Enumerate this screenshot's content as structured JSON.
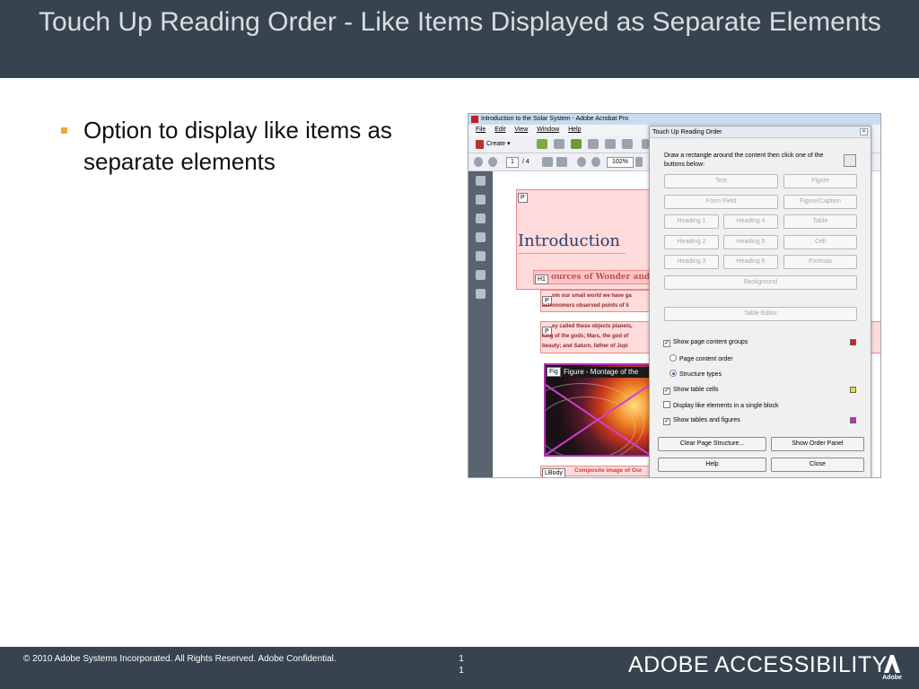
{
  "slide": {
    "title": "Touch Up Reading Order - Like Items Displayed as Separate Elements",
    "bullet": "Option to display like items as separate elements"
  },
  "acrobat": {
    "window_title": "Introduction to the Solar System - Adobe Acrobat Pro",
    "menu": [
      "File",
      "Edit",
      "View",
      "Window",
      "Help"
    ],
    "create_label": "Create",
    "page_current": "1",
    "page_total": "/ 4",
    "zoom": "102%",
    "document": {
      "heading": "Introduction",
      "subheading": "ources of Wonder and",
      "para1_line1": "om our small world we have ga",
      "para1_line2": "astronomers observed points of li",
      "para2_line1": "ey called these objects planets,",
      "para2_line2": "king of the gods; Mars, the god of",
      "para2_line3": "beauty; and Saturn, father of Jupi",
      "figure_caption": "Figure - Montage of the",
      "lbody_text": "Composite image of Our",
      "tags": {
        "p1": "P",
        "h1": "H1",
        "p2": "P",
        "p3": "P",
        "fig": "Fig",
        "lbody": "LBody"
      }
    }
  },
  "dialog": {
    "title": "Touch Up Reading Order",
    "close_glyph": "×",
    "instructions": "Draw a rectangle around the content then click one of the buttons below:",
    "buttons": {
      "text": "Text",
      "figure": "Figure",
      "form_field": "Form Field",
      "figure_caption": "Figure/Caption",
      "heading1": "Heading 1",
      "heading4": "Heading 4",
      "table": "Table",
      "heading2": "Heading 2",
      "heading5": "Heading 5",
      "cell": "Cell",
      "heading3": "Heading 3",
      "heading6": "Heading 6",
      "formula": "Formula",
      "background": "Background",
      "table_editor": "Table Editor",
      "clear_page_structure": "Clear Page Structure...",
      "show_order_panel": "Show Order Panel",
      "help": "Help",
      "close": "Close"
    },
    "options": {
      "show_page_content_groups": "Show page content groups",
      "page_content_order": "Page content order",
      "structure_types": "Structure types",
      "show_table_cells": "Show table cells",
      "display_like_elements": "Display like elements in a single block",
      "show_tables_and_figures": "Show tables and figures"
    },
    "checked_glyph": "✓",
    "swatch_colors": {
      "content_groups": "#cc2222",
      "table_cells": "#e8e030",
      "tables_figures": "#c030c0"
    }
  },
  "footer": {
    "copyright": "© 2010 Adobe Systems Incorporated.  All Rights Reserved.  Adobe Confidential.",
    "slide_num_top": "1",
    "slide_num_bottom": "1",
    "brand": "ADOBE ACCESSIBILITY",
    "logo_text": "Adobe"
  },
  "colors": {
    "bar": "#37444f",
    "bullet": "#f0a832"
  }
}
